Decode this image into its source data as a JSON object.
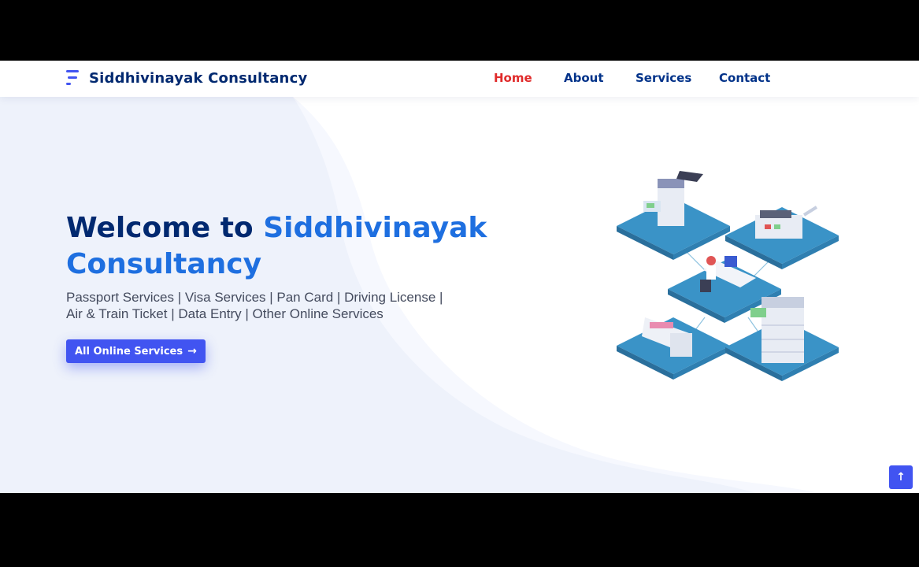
{
  "header": {
    "brand": "Siddhivinayak Consultancy",
    "nav": [
      {
        "label": "Home",
        "active": true
      },
      {
        "label": "About",
        "active": false
      },
      {
        "label": "Services",
        "active": false
      },
      {
        "label": "Contact",
        "active": false
      }
    ]
  },
  "hero": {
    "title_prefix": "Welcome to ",
    "title_accent": "Siddhivinayak Consultancy",
    "subtitle_line1": "Passport Services | Visa Services | Pan Card | Driving License |",
    "subtitle_line2": "Air & Train Ticket | Data Entry | Other Online Services",
    "cta_label": "All Online Services",
    "cta_icon": "arrow-right-icon"
  },
  "back_to_top_icon": "arrow-up-icon",
  "colors": {
    "primary": "#4154f1",
    "heading": "#012970",
    "accent": "#1e6fe0",
    "nav_active": "#e02a2a",
    "nav_text": "#013289",
    "platform": "#3a93c7"
  }
}
